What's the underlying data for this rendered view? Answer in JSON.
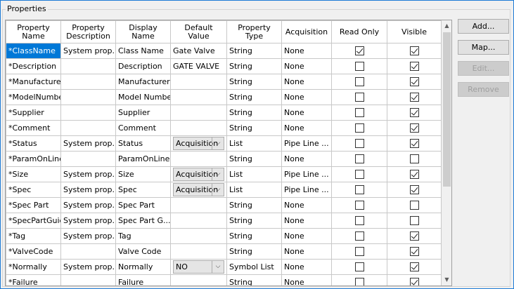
{
  "group_title": "Properties",
  "columns": [
    "Property Name",
    "Property Description",
    "Display Name",
    "Default Value",
    "Property Type",
    "Acquisition",
    "Read Only",
    "Visible"
  ],
  "rows": [
    {
      "name": "*ClassName",
      "desc": "System prop...",
      "display": "Class Name",
      "default": "Gate Valve",
      "default_combo": false,
      "type": "String",
      "acq": "None",
      "readonly": true,
      "visible": true,
      "selected": true
    },
    {
      "name": "*Description",
      "desc": "",
      "display": "Description",
      "default": "GATE VALVE",
      "default_combo": false,
      "type": "String",
      "acq": "None",
      "readonly": false,
      "visible": true
    },
    {
      "name": "*Manufacturer",
      "desc": "",
      "display": "Manufacturer",
      "default": "",
      "default_combo": false,
      "type": "String",
      "acq": "None",
      "readonly": false,
      "visible": true
    },
    {
      "name": "*ModelNumber",
      "desc": "",
      "display": "Model Number",
      "default": "",
      "default_combo": false,
      "type": "String",
      "acq": "None",
      "readonly": false,
      "visible": true
    },
    {
      "name": "*Supplier",
      "desc": "",
      "display": "Supplier",
      "default": "",
      "default_combo": false,
      "type": "String",
      "acq": "None",
      "readonly": false,
      "visible": true
    },
    {
      "name": "*Comment",
      "desc": "",
      "display": "Comment",
      "default": "",
      "default_combo": false,
      "type": "String",
      "acq": "None",
      "readonly": false,
      "visible": true
    },
    {
      "name": "*Status",
      "desc": "System prop...",
      "display": "Status",
      "default": "Acquisition",
      "default_combo": true,
      "type": "List",
      "acq": "Pipe Line ...",
      "readonly": false,
      "visible": true
    },
    {
      "name": "*ParamOnLine",
      "desc": "",
      "display": "ParamOnLine",
      "default": "",
      "default_combo": false,
      "type": "String",
      "acq": "None",
      "readonly": false,
      "visible": false
    },
    {
      "name": "*Size",
      "desc": "System prop...",
      "display": "Size",
      "default": "Acquisition",
      "default_combo": true,
      "type": "List",
      "acq": "Pipe Line ...",
      "readonly": false,
      "visible": true
    },
    {
      "name": "*Spec",
      "desc": "System prop...",
      "display": "Spec",
      "default": "Acquisition",
      "default_combo": true,
      "type": "List",
      "acq": "Pipe Line ...",
      "readonly": false,
      "visible": true
    },
    {
      "name": "*Spec Part",
      "desc": "System prop...",
      "display": "Spec Part",
      "default": "",
      "default_combo": false,
      "type": "String",
      "acq": "None",
      "readonly": false,
      "visible": false
    },
    {
      "name": "*SpecPartGuid",
      "desc": "System prop...",
      "display": "Spec Part G...",
      "default": "",
      "default_combo": false,
      "type": "String",
      "acq": "None",
      "readonly": false,
      "visible": false
    },
    {
      "name": "*Tag",
      "desc": "System prop...",
      "display": "Tag",
      "default": "",
      "default_combo": false,
      "type": "String",
      "acq": "None",
      "readonly": false,
      "visible": true
    },
    {
      "name": "*ValveCode",
      "desc": "",
      "display": "Valve Code",
      "default": "",
      "default_combo": false,
      "type": "String",
      "acq": "None",
      "readonly": false,
      "visible": true
    },
    {
      "name": "*Normally",
      "desc": "System prop...",
      "display": "Normally",
      "default": "NO",
      "default_combo": true,
      "type": "Symbol List",
      "acq": "None",
      "readonly": false,
      "visible": true
    },
    {
      "name": "*Failure",
      "desc": "",
      "display": "Failure",
      "default": "",
      "default_combo": false,
      "type": "String",
      "acq": "None",
      "readonly": false,
      "visible": true
    }
  ],
  "buttons": {
    "add": "Add...",
    "map": "Map...",
    "edit": "Edit...",
    "remove": "Remove"
  },
  "icons": {
    "scroll_up": "▲",
    "scroll_down": "▼",
    "combo_arrow": "⌵"
  }
}
